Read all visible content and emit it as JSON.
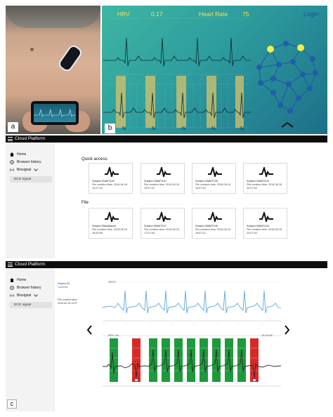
{
  "panel_labels": {
    "a": "a",
    "b": "b",
    "c": "c"
  },
  "app_screen": {
    "hrv_label": "HRV",
    "hrv_value": "0.17",
    "heart_rate_label": "Heart Rate",
    "heart_rate_value": "75",
    "login_label": "Login",
    "beat_labels": [
      "N",
      "N",
      "N",
      "N",
      "N"
    ],
    "icons": {
      "brain": "brain-network-icon",
      "chevron": "chevron-up-icon"
    },
    "colors": {
      "gradient_start": "#3fb6a3",
      "gradient_end": "#1d6f8a",
      "metric_text": "#f4e35a",
      "highlight": "#d8c26a"
    }
  },
  "platform": {
    "title": "Cloud Platform",
    "nav": [
      {
        "icon": "home-icon",
        "label": "Home"
      },
      {
        "icon": "history-icon",
        "label": "Browser history"
      },
      {
        "icon": "biosignal-icon",
        "label": "Biosignal"
      }
    ],
    "sub_item": "ECG signal",
    "quick_access_title": "Quick access",
    "file_title": "File",
    "quick_cards": [
      {
        "subject": "Subject 01#MT100",
        "date": "File creation time: 2018 08 18 14:07:40"
      },
      {
        "subject": "Subject 03#MT110",
        "date": "File creation time: 2018 08 18 15:57:40"
      },
      {
        "subject": "Subject 03#MT105",
        "date": "File creation time: 2018 08 24 16:57:20"
      },
      {
        "subject": "Subject 04#MT104",
        "date": "File creation time: 2018 08 26 20:07:40"
      }
    ],
    "file_cards": [
      {
        "subject": "Subject 05#wikisubs",
        "date": "File creation time: 2018 08 18 16:05:58"
      },
      {
        "subject": "Subject 05#MT107",
        "date": "File creation time: 2018 08 20 17:07:46"
      },
      {
        "subject": "Subject 05#MT108",
        "date": "File creation time: 2018 08 24 16:57:22"
      },
      {
        "subject": "Subject 05#MT104",
        "date": "File creation time: 2018 08 28 20:07:40"
      }
    ]
  },
  "viewer": {
    "subject_label": "Subject 05",
    "subject_value": "Yookmon",
    "file_info": "File creation time: 2018 08 18 14:07",
    "trace_label": "ECG",
    "detail_left_label": "BPS: 48",
    "detail_right_label": "16:42:58",
    "prev_icon": "chevron-left-icon",
    "next_icon": "chevron-right-icon",
    "segment_classes": [
      "green",
      "red",
      "green",
      "green",
      "green",
      "green",
      "green",
      "green",
      "green",
      "green",
      "red"
    ],
    "colors": {
      "green": "#1e9a3c",
      "red": "#d72a26",
      "trace": "#5ea8d8"
    }
  }
}
